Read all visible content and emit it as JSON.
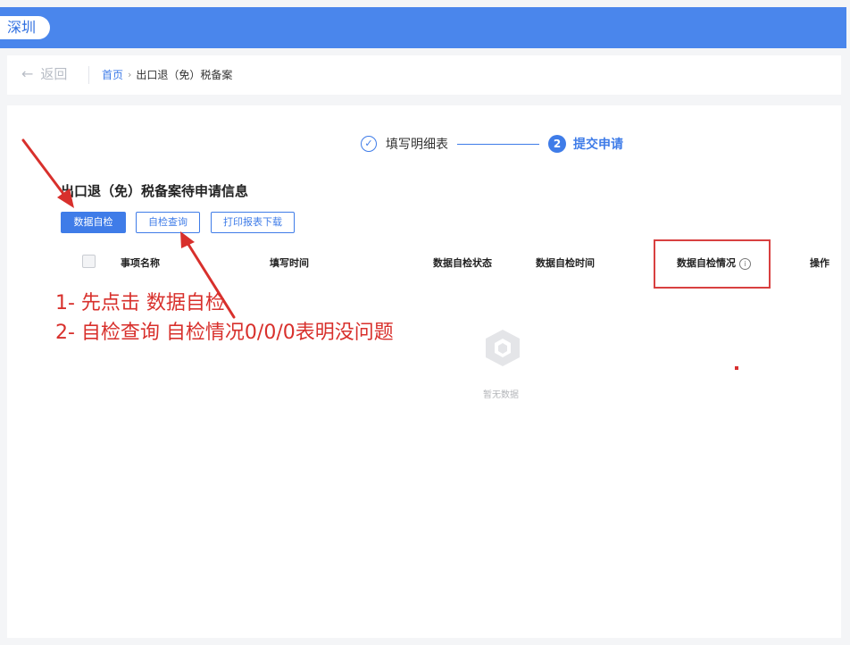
{
  "header": {
    "city": "深圳"
  },
  "navbar": {
    "back_label": "返回",
    "breadcrumb_home": "首页",
    "breadcrumb_separator": "›",
    "breadcrumb_current": "出口退（免）税备案"
  },
  "steps": {
    "step1_label": "填写明细表",
    "step2_number": "2",
    "step2_label": "提交申请"
  },
  "section": {
    "title": "出口退（免）税备案待申请信息"
  },
  "toolbar": {
    "self_check_label": "数据自检",
    "self_check_query_label": "自检查询",
    "print_download_label": "打印报表下载"
  },
  "table": {
    "columns": [
      "事项名称",
      "填写时间",
      "数据自检状态",
      "数据自检时间",
      "数据自检情况",
      "操作"
    ],
    "empty_text": "暂无数据"
  },
  "annotations": {
    "line1": "1- 先点击  数据自检",
    "line2": "2- 自检查询  自检情况0/0/0表明没问题"
  },
  "colors": {
    "primary": "#3f7ce8",
    "topbar": "#4a86ec",
    "annotation_red": "#d8302c"
  }
}
